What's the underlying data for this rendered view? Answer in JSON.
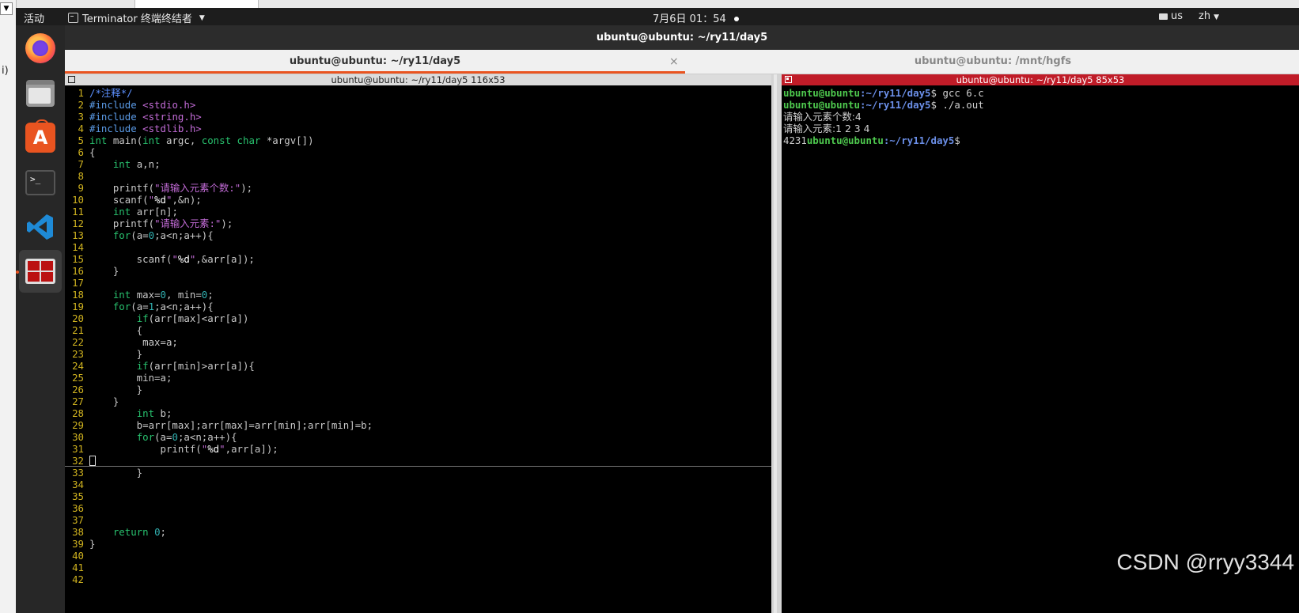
{
  "host": {
    "fragment_text": "ⅰ)"
  },
  "topbar": {
    "activities": "活动",
    "app_menu": "Terminator 终端终结者",
    "clock": "7月6日  01：54",
    "keyboard": "us",
    "lang": "zh"
  },
  "dock": {
    "items": [
      "firefox-icon",
      "files-icon",
      "software-store-icon",
      "terminal-icon",
      "vscode-icon",
      "terminator-icon"
    ],
    "store_glyph": "A",
    "terminal_glyph": ">_"
  },
  "window": {
    "title": "ubuntu@ubuntu: ~/ry11/day5",
    "tabs": [
      {
        "label": "ubuntu@ubuntu: ~/ry11/day5",
        "active": true
      },
      {
        "label": "ubuntu@ubuntu: /mnt/hgfs",
        "active": false
      }
    ],
    "tab_close": "×"
  },
  "left_pane": {
    "title": "ubuntu@ubuntu: ~/ry11/day5 116x53",
    "line_numbers": [
      "1",
      "2",
      "3",
      "4",
      "5",
      "6",
      "7",
      "8",
      "9",
      "10",
      "11",
      "12",
      "13",
      "14",
      "15",
      "16",
      "17",
      "18",
      "19",
      "20",
      "21",
      "22",
      "23",
      "24",
      "25",
      "26",
      "27",
      "28",
      "29",
      "30",
      "31",
      "32",
      "33",
      "34",
      "35",
      "36",
      "37",
      "38",
      "39",
      "40",
      "41",
      "42"
    ],
    "code": {
      "l1": "/*注释*/",
      "l2a": "#include ",
      "l2b": "<stdio.h>",
      "l3a": "#include ",
      "l3b": "<string.h>",
      "l4a": "#include ",
      "l4b": "<stdlib.h>",
      "l5a": "int",
      "l5b": " main(",
      "l5c": "int",
      "l5d": " argc, ",
      "l5e": "const",
      "l5f": " ",
      "l5g": "char",
      "l5h": " *argv[])",
      "l6": "{",
      "l7a": "    ",
      "l7b": "int",
      "l7c": " a,n;",
      "l9a": "    printf(",
      "l9b": "\"请输入元素个数:\"",
      "l9c": ");",
      "l10a": "    scanf(",
      "l10b": "\"",
      "l10c": "%d",
      "l10d": "\"",
      "l10e": ",&n);",
      "l11a": "    ",
      "l11b": "int",
      "l11c": " arr[n];",
      "l12a": "    printf(",
      "l12b": "\"请输入元素:\"",
      "l12c": ");",
      "l13a": "    ",
      "l13b": "for",
      "l13c": "(a=",
      "l13d": "0",
      "l13e": ";a<n;a++){",
      "l15a": "        scanf(",
      "l15b": "\"",
      "l15c": "%d",
      "l15d": "\"",
      "l15e": ",&arr[a]);",
      "l16": "    }",
      "l18a": "    ",
      "l18b": "int",
      "l18c": " max=",
      "l18d": "0",
      "l18e": ", min=",
      "l18f": "0",
      "l18g": ";",
      "l19a": "    ",
      "l19b": "for",
      "l19c": "(a=",
      "l19d": "1",
      "l19e": ";a<n;a++){",
      "l20a": "        ",
      "l20b": "if",
      "l20c": "(arr[max]<arr[a])",
      "l21": "        {",
      "l22": "         max=a;",
      "l23": "        }",
      "l24a": "        ",
      "l24b": "if",
      "l24c": "(arr[min]>arr[a]){",
      "l25": "        min=a;",
      "l26": "        }",
      "l27": "    }",
      "l28a": "        ",
      "l28b": "int",
      "l28c": " b;",
      "l29": "        b=arr[max];arr[max]=arr[min];arr[min]=b;",
      "l30a": "        ",
      "l30b": "for",
      "l30c": "(a=",
      "l30d": "0",
      "l30e": ";a<n;a++){",
      "l31a": "            printf(",
      "l31b": "\"",
      "l31c": "%d",
      "l31d": "\"",
      "l31e": ",arr[a]);",
      "l33": "        }",
      "l38a": "    ",
      "l38b": "return",
      "l38c": " ",
      "l38d": "0",
      "l38e": ";",
      "l39": "}"
    }
  },
  "right_pane": {
    "title": "ubuntu@ubuntu: ~/ry11/day5 85x53",
    "user": "ubuntu@ubuntu",
    "path": ":~/ry11/day5",
    "prompt_sym": "$",
    "cmd1": " gcc 6.c",
    "cmd2": " ./a.out",
    "out1": "请输入元素个数:4",
    "out2": "请输入元素:1 2 3 4",
    "out3_prefix": "4231"
  },
  "watermark": "CSDN @rryy3344"
}
